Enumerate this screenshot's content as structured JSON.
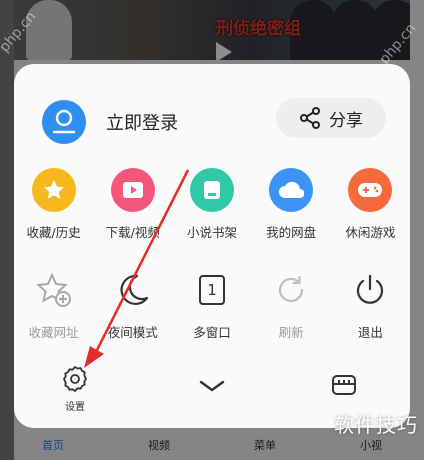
{
  "background": {
    "video_banner": "刑侦绝密组",
    "tabs": [
      "首页",
      "视频",
      "菜单",
      "小视"
    ],
    "watermark_left": "php.cn",
    "watermark_right": "php.cn"
  },
  "login": {
    "label": "立即登录",
    "icon": "person-icon"
  },
  "share": {
    "label": "分享",
    "icon": "share-icon"
  },
  "grid_row1": [
    {
      "label": "收藏/历史",
      "icon": "star-icon",
      "color": "#f6b81c"
    },
    {
      "label": "下载/视频",
      "icon": "download-video-icon",
      "color": "#f4577a"
    },
    {
      "label": "小说书架",
      "icon": "bookshelf-icon",
      "color": "#2fc9a8"
    },
    {
      "label": "我的网盘",
      "icon": "cloud-icon",
      "color": "#3a93f5"
    },
    {
      "label": "休闲游戏",
      "icon": "gamepad-icon",
      "color": "#f56a3c"
    }
  ],
  "grid_row2": [
    {
      "label": "收藏网址",
      "icon": "star-add-icon",
      "muted": true
    },
    {
      "label": "夜间模式",
      "icon": "moon-icon",
      "muted": false
    },
    {
      "label": "多窗口",
      "icon": "window-count-icon",
      "count": "1",
      "muted": false
    },
    {
      "label": "刷新",
      "icon": "refresh-icon",
      "muted": true
    },
    {
      "label": "退出",
      "icon": "power-icon",
      "muted": false
    }
  ],
  "bottom": {
    "settings_label": "设置"
  },
  "corner_watermark": "软件技巧"
}
